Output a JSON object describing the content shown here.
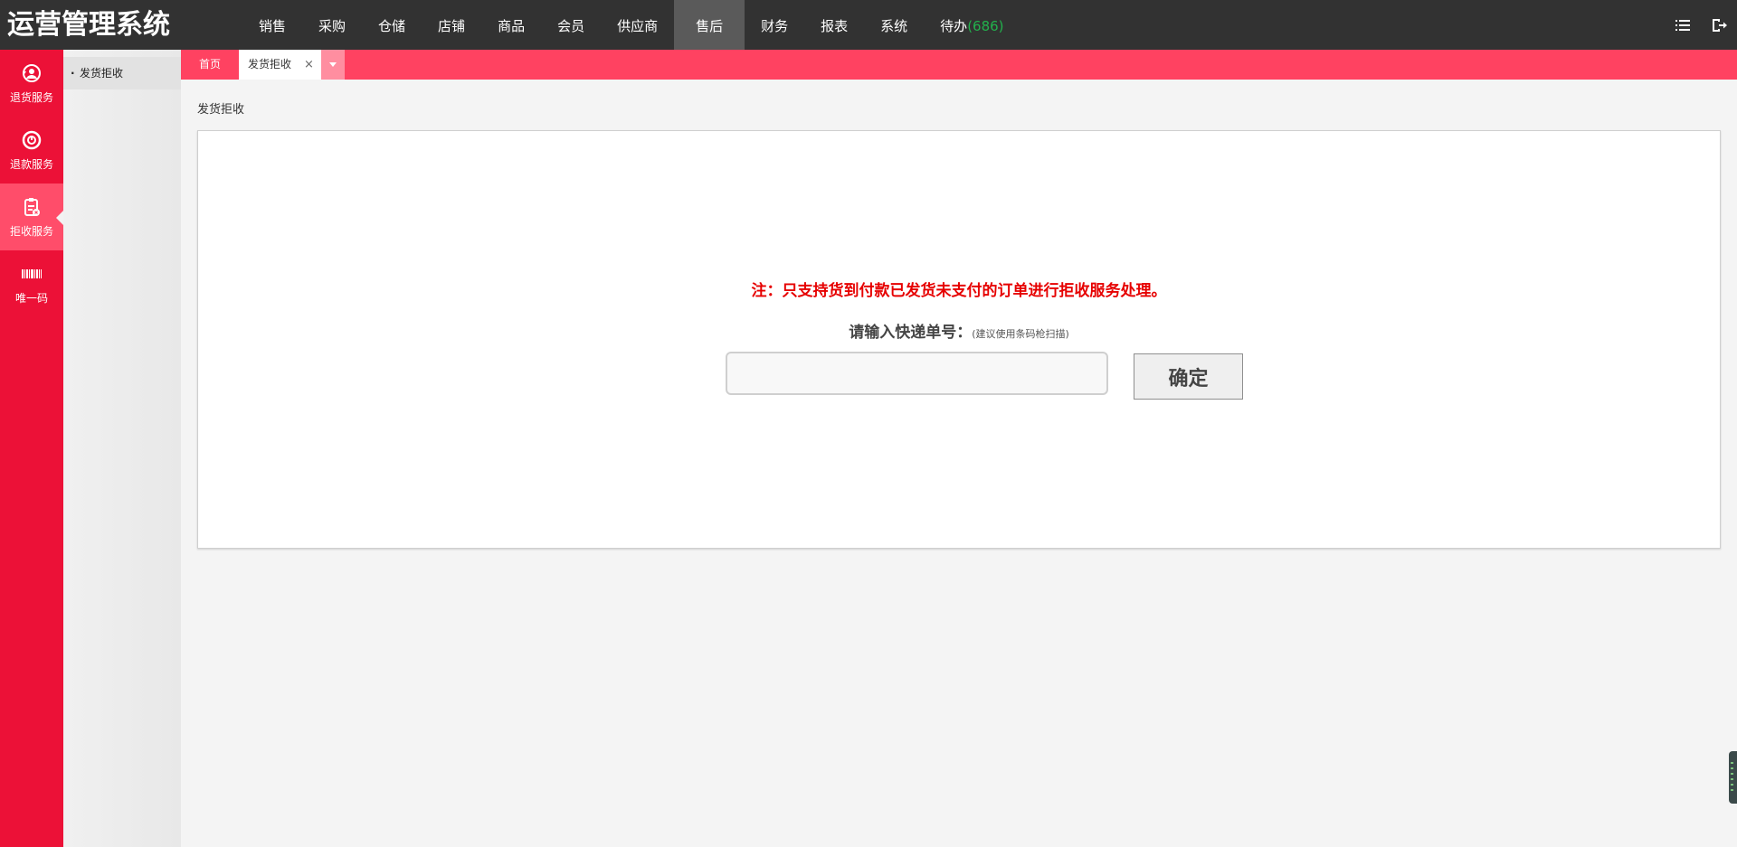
{
  "app": {
    "title": "运营管理系统"
  },
  "nav": {
    "items": [
      {
        "label": "销售"
      },
      {
        "label": "采购"
      },
      {
        "label": "仓储"
      },
      {
        "label": "店铺"
      },
      {
        "label": "商品"
      },
      {
        "label": "会员"
      },
      {
        "label": "供应商"
      },
      {
        "label": "售后",
        "active": true
      },
      {
        "label": "财务"
      },
      {
        "label": "报表"
      },
      {
        "label": "系统"
      }
    ],
    "todo_label": "待办",
    "todo_count": "(686)",
    "todo_count_color": "#22b14c",
    "right_icons": [
      "list-icon",
      "logout-icon"
    ]
  },
  "sidebar": {
    "items": [
      {
        "label": "退货服务",
        "icon": "return-service-icon"
      },
      {
        "label": "退款服务",
        "icon": "refund-service-icon"
      },
      {
        "label": "拒收服务",
        "icon": "reject-service-icon",
        "active": true
      },
      {
        "label": "唯一码",
        "icon": "barcode-icon"
      }
    ]
  },
  "submenu": {
    "items": [
      {
        "label": "发货拒收",
        "active": true
      }
    ]
  },
  "tabs": {
    "home_label": "首页",
    "active_label": "发货拒收",
    "close_symbol": "×"
  },
  "main": {
    "page_title": "发货拒收",
    "notice": "注：只支持货到付款已发货未支付的订单进行拒收服务处理。",
    "prompt_label": "请输入快递单号：",
    "prompt_hint": "(建议使用条码枪扫描)",
    "express_input": {
      "value": "",
      "placeholder": ""
    },
    "confirm_label": "确定"
  },
  "colors": {
    "topbar": "#323232",
    "sidebar": "#ec1137",
    "tabbar": "#ff4261",
    "notice": "#e60000"
  }
}
